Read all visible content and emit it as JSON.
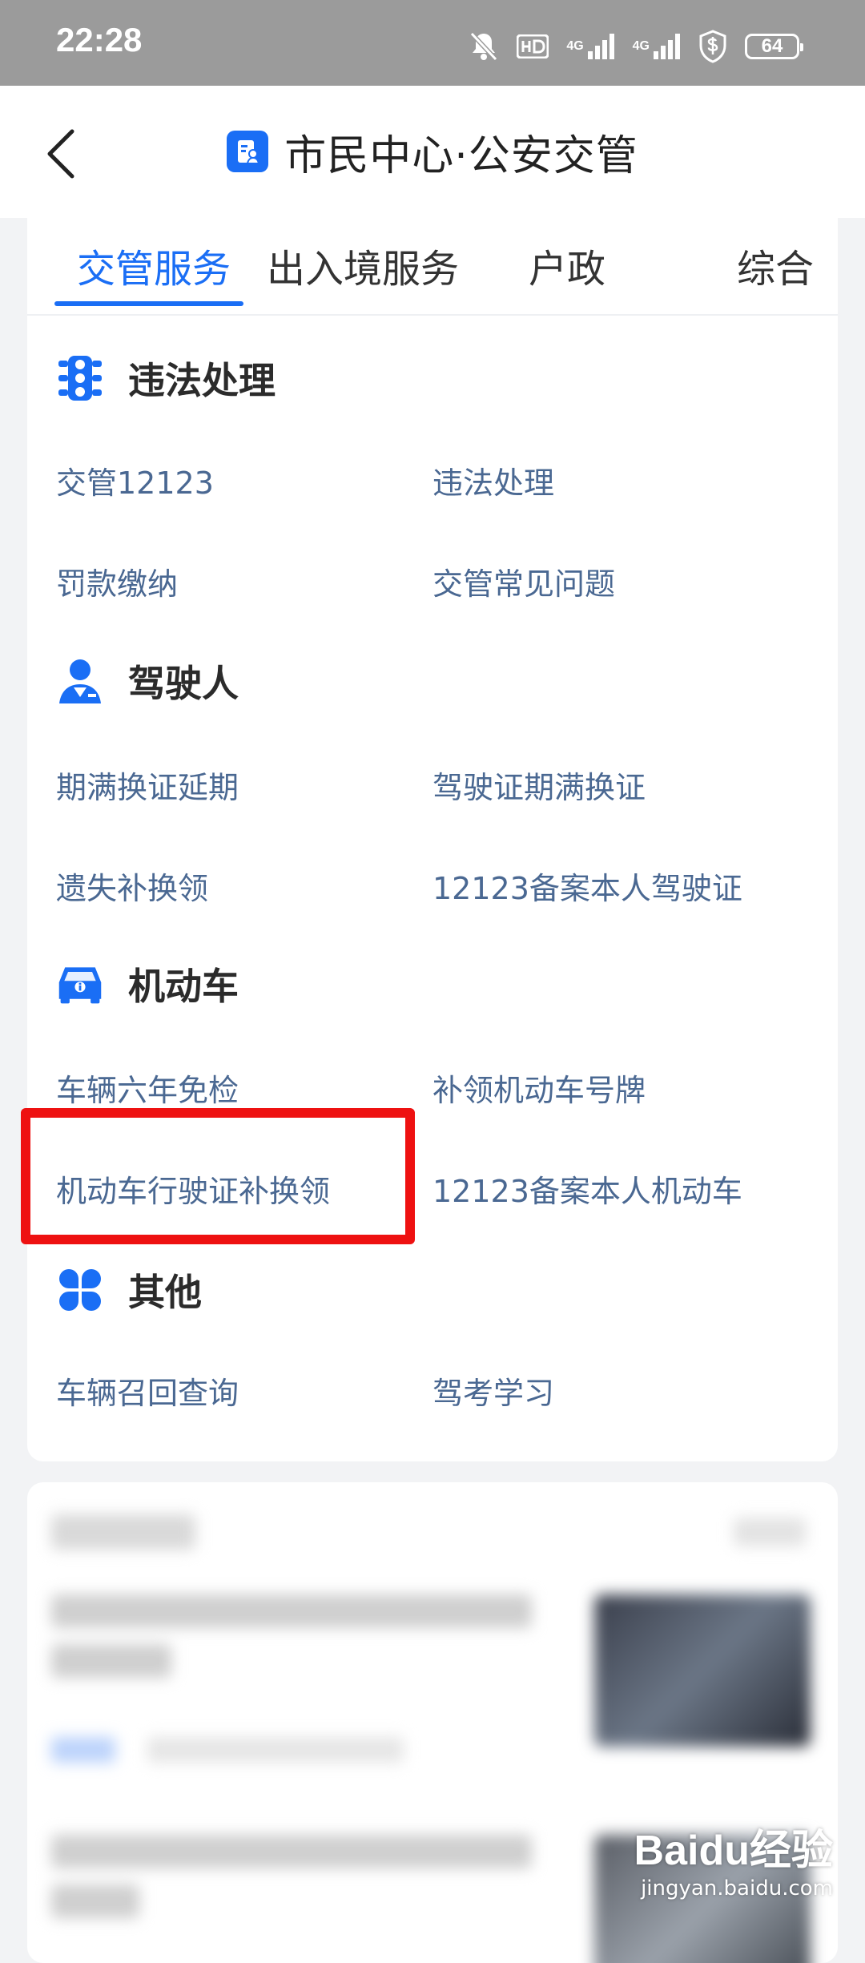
{
  "status_bar": {
    "time": "22:28",
    "net1": "4G",
    "net2": "4G",
    "battery": "64",
    "icons": [
      "mute-bell-icon",
      "hd-icon",
      "signal-icon",
      "signal-icon",
      "shield-dollar-icon",
      "battery-icon"
    ]
  },
  "header": {
    "title": "市民中心·公安交管",
    "back_icon": "chevron-left-icon",
    "app_icon": "id-document-icon"
  },
  "tabs": [
    {
      "label": "交管服务",
      "active": true
    },
    {
      "label": "出入境服务",
      "active": false
    },
    {
      "label": "户政",
      "active": false
    },
    {
      "label": "综合",
      "active": false
    }
  ],
  "sections": [
    {
      "title": "违法处理",
      "icon": "traffic-light-icon",
      "items": [
        "交管12123",
        "违法处理",
        "罚款缴纳",
        "交管常见问题"
      ]
    },
    {
      "title": "驾驶人",
      "icon": "driver-icon",
      "items": [
        "期满换证延期",
        "驾驶证期满换证",
        "遗失补换领",
        "12123备案本人驾驶证"
      ]
    },
    {
      "title": "机动车",
      "icon": "car-icon",
      "items": [
        "车辆六年免检",
        "补领机动车号牌",
        "机动车行驶证补换领",
        "12123备案本人机动车"
      ]
    },
    {
      "title": "其他",
      "icon": "four-petal-icon",
      "items": [
        "车辆召回查询",
        "驾考学习"
      ]
    }
  ],
  "highlighted_item": "机动车行驶证补换领",
  "colors": {
    "accent": "#1a6ef5",
    "link": "#4a6892",
    "highlight": "#ee1111",
    "status_bar": "#9b9b9b"
  },
  "watermark": {
    "brand": "Baidu经验",
    "url": "jingyan.baidu.com"
  }
}
